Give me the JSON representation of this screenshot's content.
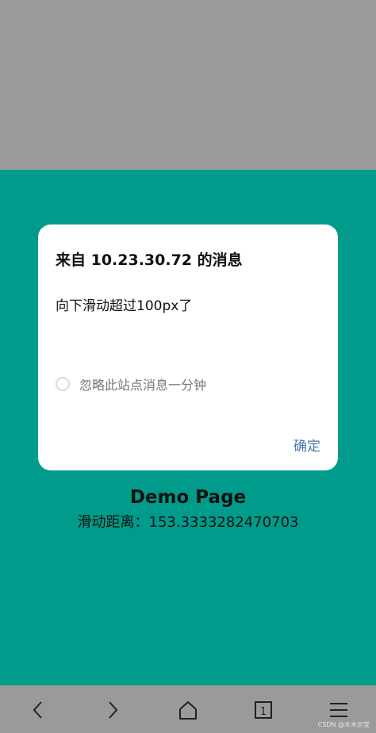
{
  "dialog": {
    "title": "来自 10.23.30.72 的消息",
    "message": "向下滑动超过100px了",
    "ignore_label": "忽略此站点消息一分钟",
    "ok_label": "确定"
  },
  "page": {
    "title": "Demo Page",
    "scroll_label": "滑动距离：",
    "scroll_value": "153.3333282470703"
  },
  "watermark": "CSDN @木木示宝",
  "navbar": {
    "tab_count": "1",
    "icons": [
      "back-icon",
      "forward-icon",
      "home-icon",
      "tabs-icon",
      "menu-icon"
    ]
  },
  "colors": {
    "teal": "#009b8b",
    "gray": "#9a9a9a",
    "ok_blue": "#4a7ab0"
  }
}
